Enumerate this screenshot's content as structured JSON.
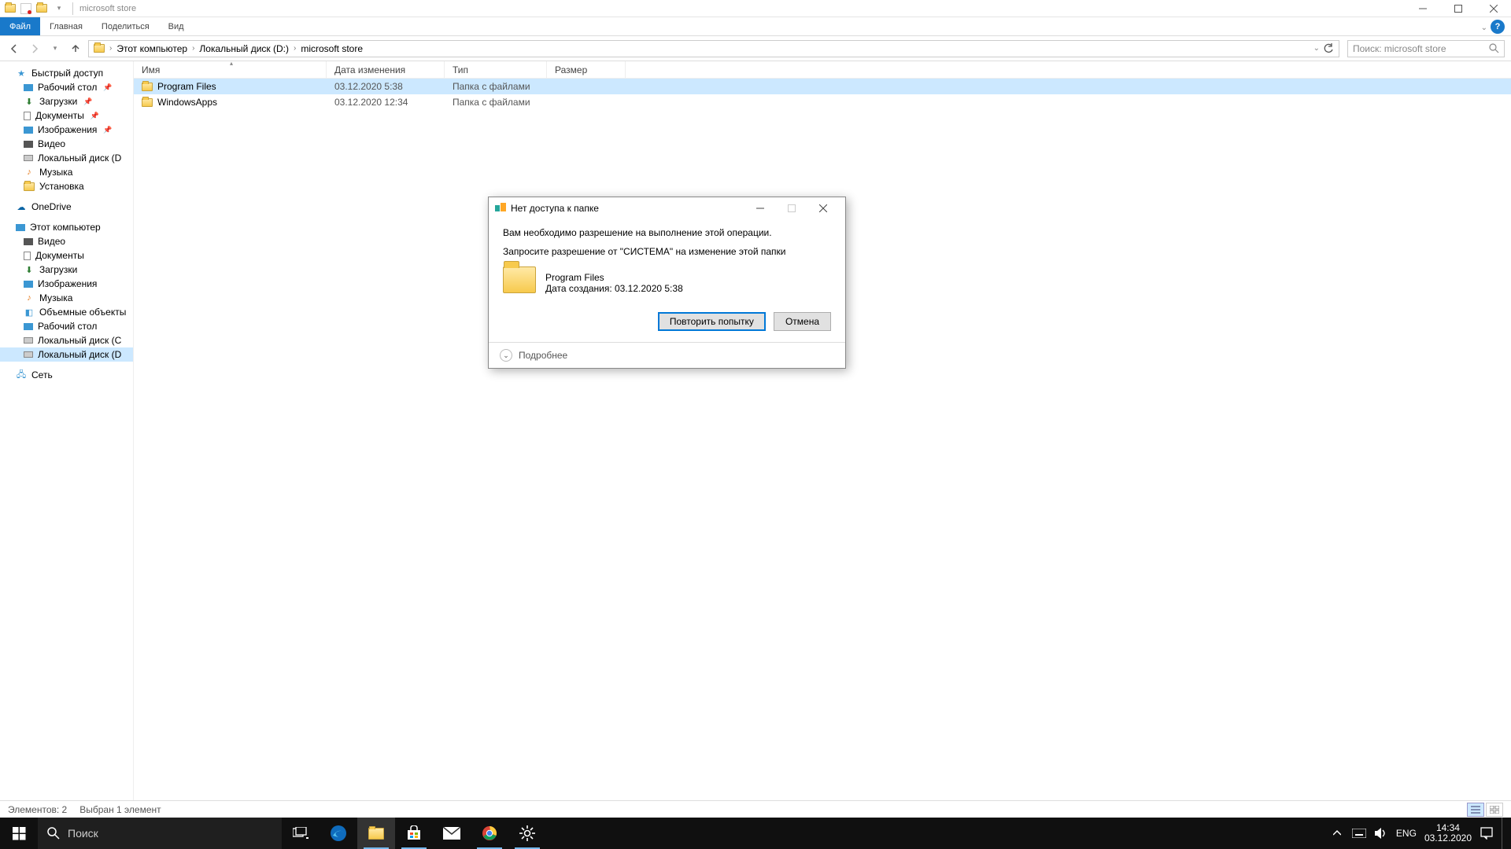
{
  "window": {
    "title": "microsoft store"
  },
  "ribbon": {
    "file": "Файл",
    "tabs": [
      "Главная",
      "Поделиться",
      "Вид"
    ]
  },
  "breadcrumbs": [
    "Этот компьютер",
    "Локальный диск (D:)",
    "microsoft store"
  ],
  "search": {
    "placeholder": "Поиск: microsoft store"
  },
  "columns": {
    "name": "Имя",
    "date": "Дата изменения",
    "type": "Тип",
    "size": "Размер"
  },
  "rows": [
    {
      "name": "Program Files",
      "date": "03.12.2020 5:38",
      "type": "Папка с файлами",
      "selected": true
    },
    {
      "name": "WindowsApps",
      "date": "03.12.2020 12:34",
      "type": "Папка с файлами",
      "selected": false
    }
  ],
  "sidebar": {
    "quick": "Быстрый доступ",
    "quick_items": [
      "Рабочий стол",
      "Загрузки",
      "Документы",
      "Изображения",
      "Видео",
      "Локальный диск (D",
      "Музыка",
      "Установка"
    ],
    "onedrive": "OneDrive",
    "thispc": "Этот компьютер",
    "thispc_items": [
      "Видео",
      "Документы",
      "Загрузки",
      "Изображения",
      "Музыка",
      "Объемные объекты",
      "Рабочий стол",
      "Локальный диск (C",
      "Локальный диск (D"
    ],
    "network": "Сеть"
  },
  "status": {
    "count": "Элементов: 2",
    "selected": "Выбран 1 элемент"
  },
  "dialog": {
    "title": "Нет доступа к папке",
    "line1": "Вам необходимо разрешение на выполнение этой операции.",
    "line2": "Запросите разрешение от \"СИСТЕМА\" на изменение этой папки",
    "item_name": "Program Files",
    "item_meta": "Дата создания: 03.12.2020 5:38",
    "retry": "Повторить попытку",
    "cancel": "Отмена",
    "more": "Подробнее"
  },
  "taskbar": {
    "search": "Поиск",
    "lang": "ENG",
    "time": "14:34",
    "date": "03.12.2020"
  },
  "colors": {
    "accent": "#1979ca",
    "selection": "#cce8ff"
  }
}
